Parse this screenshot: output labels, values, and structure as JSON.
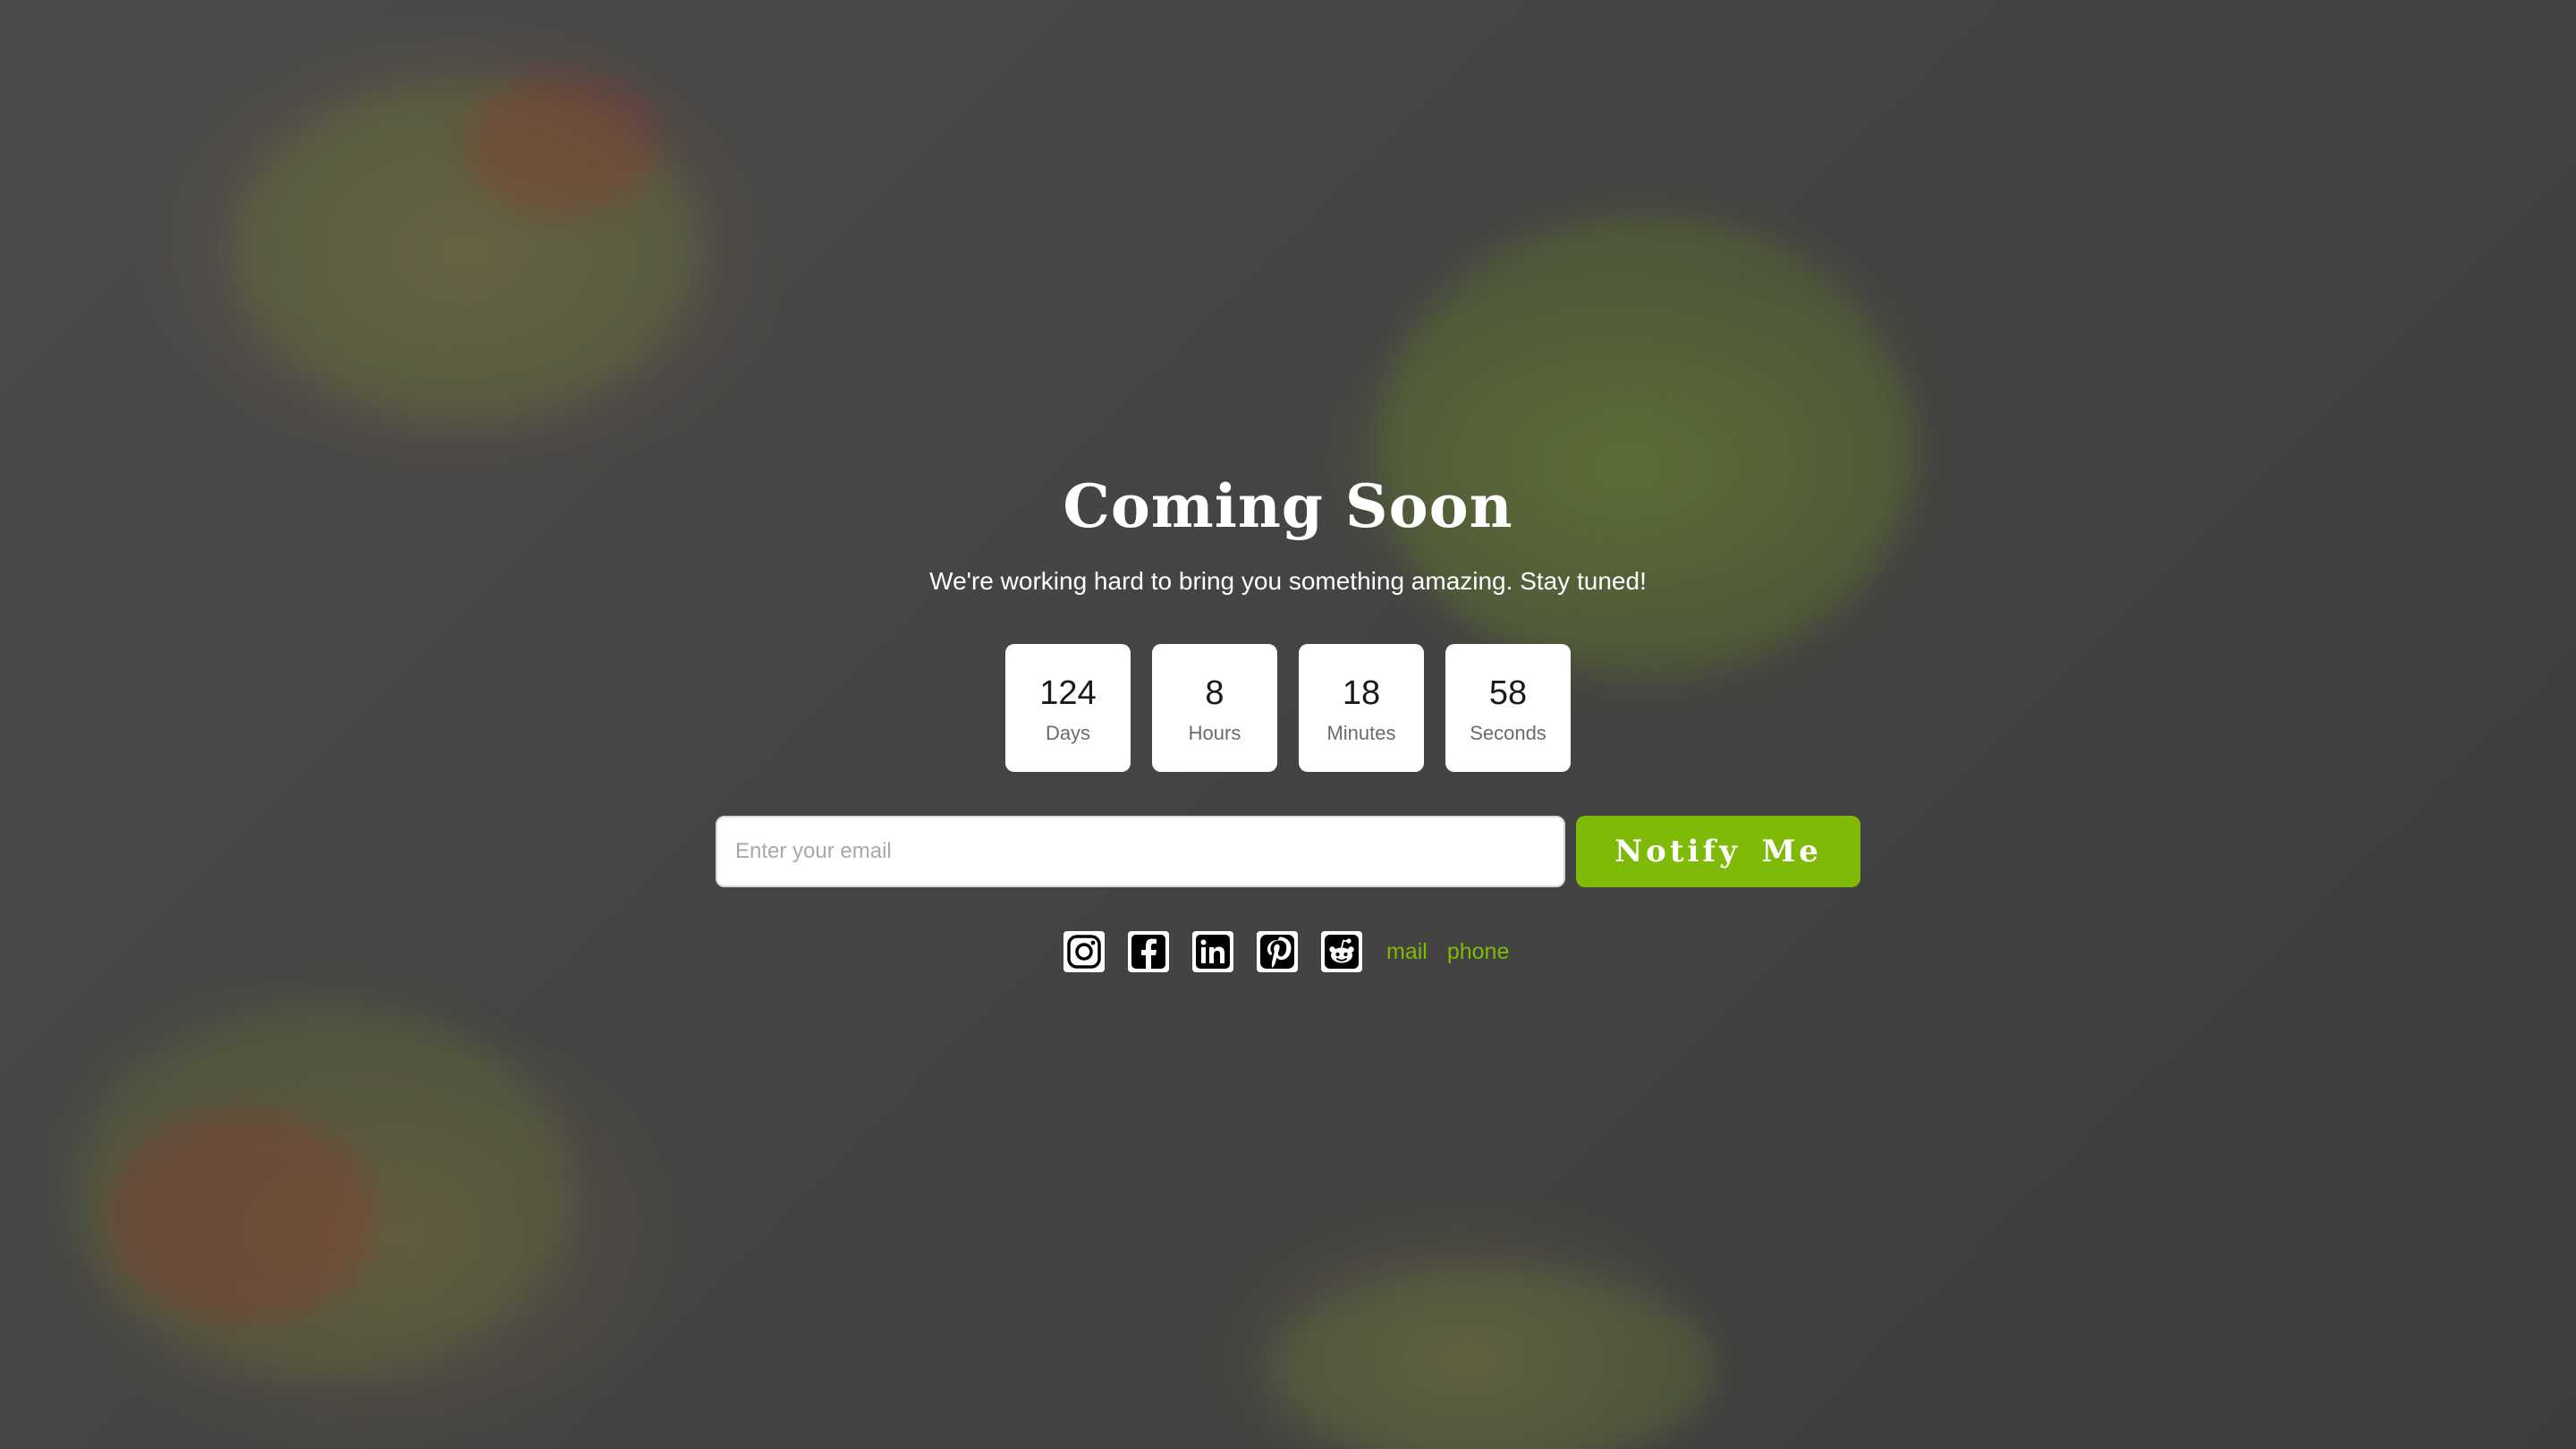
{
  "hero": {
    "title": "Coming Soon",
    "subtitle": "We're working hard to bring you something amazing. Stay tuned!"
  },
  "countdown": [
    {
      "value": "124",
      "label": "Days"
    },
    {
      "value": "8",
      "label": "Hours"
    },
    {
      "value": "18",
      "label": "Minutes"
    },
    {
      "value": "58",
      "label": "Seconds"
    }
  ],
  "form": {
    "email_placeholder": "Enter your email",
    "email_value": "",
    "notify_label": "Notify Me"
  },
  "social": {
    "icons": [
      "instagram-icon",
      "facebook-icon",
      "linkedin-icon",
      "pinterest-icon",
      "reddit-icon"
    ],
    "mail_label": "mail",
    "phone_label": "phone"
  },
  "colors": {
    "accent": "#7fba08",
    "tile_bg": "#ffffff",
    "text_light": "#ffffff"
  }
}
